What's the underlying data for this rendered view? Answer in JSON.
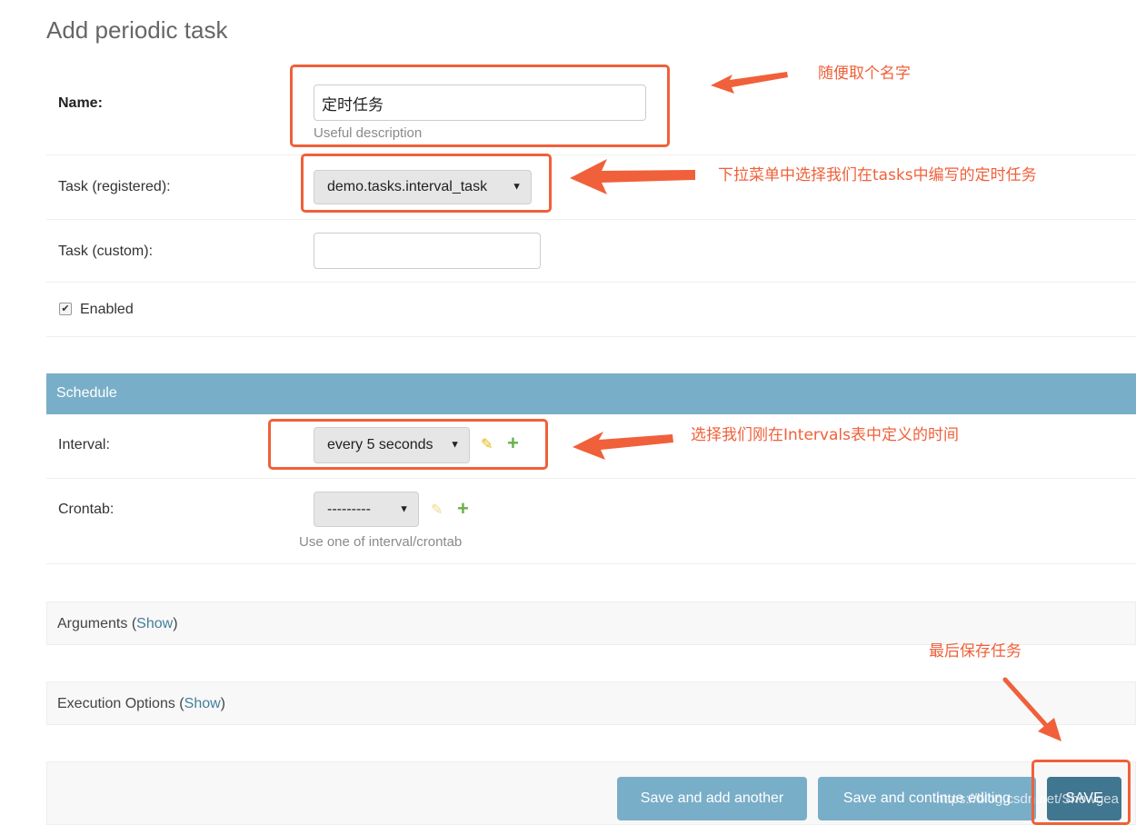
{
  "page": {
    "title": "Add periodic task"
  },
  "fields": {
    "name": {
      "label": "Name:",
      "value": "定时任务",
      "help": "Useful description"
    },
    "task_registered": {
      "label": "Task (registered):",
      "selected": "demo.tasks.interval_task"
    },
    "task_custom": {
      "label": "Task (custom):",
      "value": ""
    },
    "enabled": {
      "label": "Enabled",
      "checked": true
    }
  },
  "schedule": {
    "header": "Schedule",
    "interval": {
      "label": "Interval:",
      "selected": "every 5 seconds"
    },
    "crontab": {
      "label": "Crontab:",
      "selected": "---------",
      "help": "Use one of interval/crontab"
    }
  },
  "sections": {
    "arguments": {
      "label": "Arguments",
      "show_label": "Show"
    },
    "execution": {
      "label": "Execution Options",
      "show_label": "Show"
    }
  },
  "buttons": {
    "save_add_another": "Save and add another",
    "save_continue": "Save and continue editing",
    "save": "SAVE"
  },
  "annotations": {
    "name_note": "随便取个名字",
    "task_note": "下拉菜单中选择我们在tasks中编写的定时任务",
    "interval_note": "选择我们刚在Intervals表中定义的时间",
    "save_note": "最后保存任务"
  },
  "watermark": "https://blog.csdn.net/Showgea",
  "colors": {
    "annotation": "#f0603a",
    "schedule_bar": "#79aec8",
    "button": "#79aec8",
    "save_button": "#417690"
  }
}
